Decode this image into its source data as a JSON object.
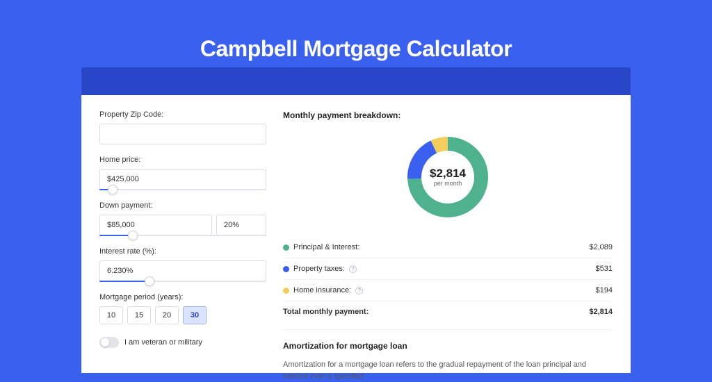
{
  "title": "Campbell Mortgage Calculator",
  "form": {
    "zip_label": "Property Zip Code:",
    "zip_value": "",
    "home_price_label": "Home price:",
    "home_price_value": "$425,000",
    "home_price_slider_pct": 8,
    "down_payment_label": "Down payment:",
    "down_payment_value": "$85,000",
    "down_payment_pct": "20%",
    "down_payment_slider_pct": 20,
    "interest_label": "Interest rate (%):",
    "interest_value": "6.230%",
    "interest_slider_pct": 30,
    "period_label": "Mortgage period (years):",
    "periods": [
      "10",
      "15",
      "20",
      "30"
    ],
    "period_active": "30",
    "veteran_label": "I am veteran or military"
  },
  "chart_data": {
    "type": "pie",
    "title": "Monthly payment breakdown:",
    "center_value": "$2,814",
    "center_sub": "per month",
    "series": [
      {
        "name": "Principal & Interest:",
        "value": 2089,
        "display": "$2,089",
        "color": "#4eb28e"
      },
      {
        "name": "Property taxes:",
        "value": 531,
        "display": "$531",
        "color": "#3a60f0",
        "info": true
      },
      {
        "name": "Home insurance:",
        "value": 194,
        "display": "$194",
        "color": "#f2cd5c",
        "info": true
      }
    ],
    "total_label": "Total monthly payment:",
    "total_value": "$2,814"
  },
  "amort": {
    "title": "Amortization for mortgage loan",
    "text": "Amortization for a mortgage loan refers to the gradual repayment of the loan principal and interest over a specified"
  }
}
